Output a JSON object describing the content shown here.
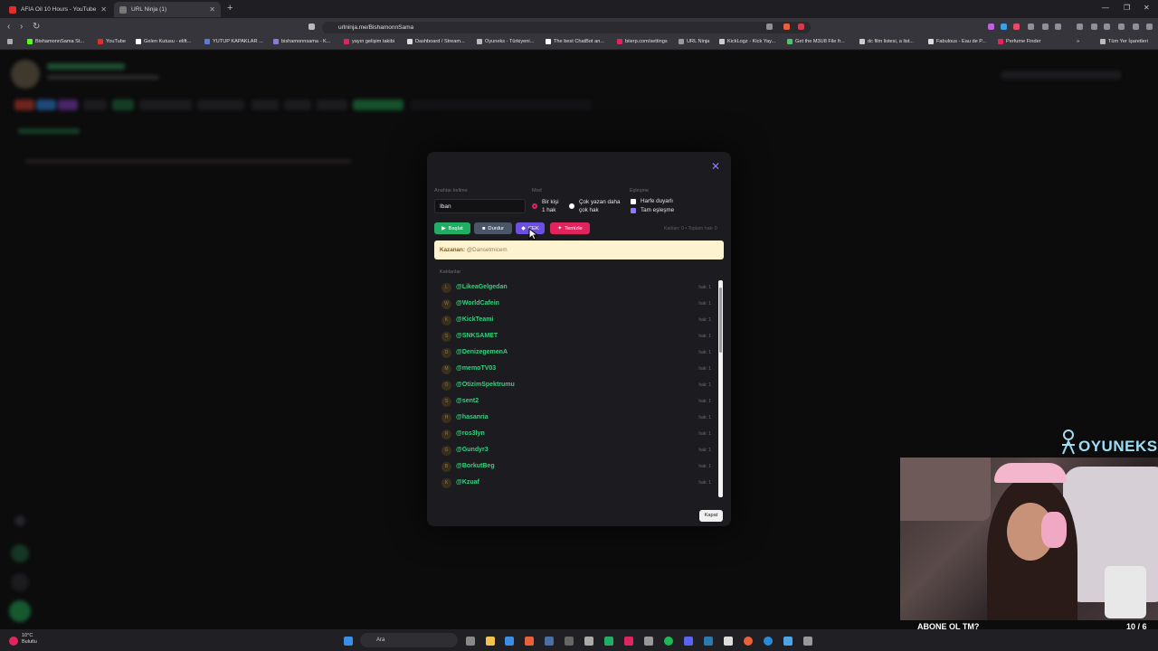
{
  "browser": {
    "tabs": [
      {
        "title": "AFIA Oil 10 Hours - YouTube",
        "active": false
      },
      {
        "title": "URL Ninja (1)",
        "active": true
      }
    ],
    "url": "urlninja.me/BishamonnSama",
    "bookmarks": [
      "BishamonnSama St...",
      "YouTube",
      "Gelen Kutusu - elift...",
      "YUTUP KAPAKLAR ...",
      "bishamonnsama - K...",
      "yayın gelişim takibi",
      "Dashboard / Stream...",
      "Oyuneks - Türkiyeni...",
      "The best ChatBot an...",
      "biierp.com/settings",
      "URL Ninja",
      "KickLogz - Kick Yay...",
      "Get the M3U8 File fr...",
      "dc film listesi, a list...",
      "Fabulous - Eau de P...",
      "Perfume Finder"
    ],
    "all_bookmarks": "Tüm Yer İşaretleri"
  },
  "modal": {
    "keyword_label": "Anahtar kelime",
    "keyword_value": "Iban",
    "mode_label": "Mod",
    "mode_option1": "Bir kişi\n1 hak",
    "mode_option2": "Çok yazan daha\nçok hak",
    "match_label": "Eşleşme",
    "match_option1": "Harfe duyarlı",
    "match_option2": "Tam eşleşme",
    "buttons": {
      "start": "Başlat",
      "stop": "Durdur",
      "draw": "ÇEK",
      "clear": "Temizle"
    },
    "stats": "Katılan: 0 • Toplam hak: 0",
    "winner_label": "Kazanan:",
    "winner_value": "@Dansetmicem",
    "participants_title": "Katılanlar",
    "participants": [
      {
        "initial": "L",
        "name": "@LikeaGelgedan",
        "hak": "hak: 1"
      },
      {
        "initial": "W",
        "name": "@WorldCafein",
        "hak": "hak: 1"
      },
      {
        "initial": "K",
        "name": "@KickTeami",
        "hak": "hak: 1"
      },
      {
        "initial": "S",
        "name": "@SNKSAMET",
        "hak": "hak: 1"
      },
      {
        "initial": "D",
        "name": "@DenizegemenA",
        "hak": "hak: 1"
      },
      {
        "initial": "M",
        "name": "@memoTV03",
        "hak": "hak: 1"
      },
      {
        "initial": "O",
        "name": "@OtizimSpektrumu",
        "hak": "hak: 1"
      },
      {
        "initial": "S",
        "name": "@sent2",
        "hak": "hak: 1"
      },
      {
        "initial": "H",
        "name": "@hasanria",
        "hak": "hak: 1"
      },
      {
        "initial": "R",
        "name": "@ros3lyn",
        "hak": "hak: 1"
      },
      {
        "initial": "G",
        "name": "@Gundyr3",
        "hak": "hak: 1"
      },
      {
        "initial": "B",
        "name": "@BorkutBeg",
        "hak": "hak: 1"
      },
      {
        "initial": "K",
        "name": "@Kzuaf",
        "hak": "hak: 1"
      }
    ],
    "close_button": "Kapat"
  },
  "overlay": {
    "brand": "OYUNEKS",
    "subscribe_text": "ABONE OL TM?",
    "subscribe_count": "10 / 6",
    "subscribe_progress": 1.0
  },
  "taskbar": {
    "weather_temp": "10°C",
    "weather_desc": "Bulutlu",
    "search_placeholder": "Ara"
  },
  "colors": {
    "start": "#1fae63",
    "stop": "#4b5568",
    "draw": "#6a4fe0",
    "clear": "#e0245e",
    "accent": "#8b7cf6",
    "participant_name": "#35d07f"
  }
}
